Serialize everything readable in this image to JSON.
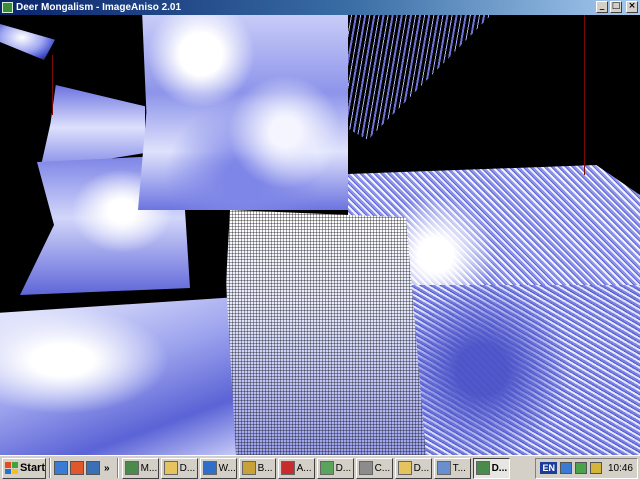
{
  "window": {
    "title": "Deer Mongalism - ImageAniso 2.01",
    "buttons": {
      "minimize": "_",
      "maximize": "□",
      "close": "×"
    }
  },
  "taskbar": {
    "start_label": "Start",
    "quick_launch": [
      {
        "icon": "internet-explorer-icon",
        "color": "#3a7bd5"
      },
      {
        "icon": "media-player-icon",
        "color": "#e0572b"
      },
      {
        "icon": "desktop-icon",
        "color": "#3b6fb6"
      }
    ],
    "overflow_label": "»",
    "tasks": [
      {
        "label": "M...",
        "icon": "app-icon",
        "color": "#4a8b4a",
        "active": false
      },
      {
        "label": "D...",
        "icon": "folder-icon",
        "color": "#e6c35c",
        "active": false
      },
      {
        "label": "W...",
        "icon": "browser-icon",
        "color": "#2f6fc9",
        "active": false
      },
      {
        "label": "B...",
        "icon": "app-icon",
        "color": "#c9a13b",
        "active": false
      },
      {
        "label": "A...",
        "icon": "pdf-icon",
        "color": "#c92c2c",
        "active": false
      },
      {
        "label": "D...",
        "icon": "app-icon",
        "color": "#5aa35a",
        "active": false
      },
      {
        "label": "C...",
        "icon": "app-icon",
        "color": "#8c8c8c",
        "active": false
      },
      {
        "label": "D...",
        "icon": "folder-icon",
        "color": "#e6c35c",
        "active": false
      },
      {
        "label": "T...",
        "icon": "document-icon",
        "color": "#6a8fd1",
        "active": false
      },
      {
        "label": "D...",
        "icon": "image-icon",
        "color": "#4a8b4a",
        "active": true
      }
    ],
    "tray": {
      "language": "EN",
      "icons": [
        {
          "icon": "network-icon",
          "color": "#3a7bd5"
        },
        {
          "icon": "security-icon",
          "color": "#4aa34a"
        },
        {
          "icon": "volume-icon",
          "color": "#d4b43a"
        }
      ],
      "clock": "10:46"
    }
  }
}
